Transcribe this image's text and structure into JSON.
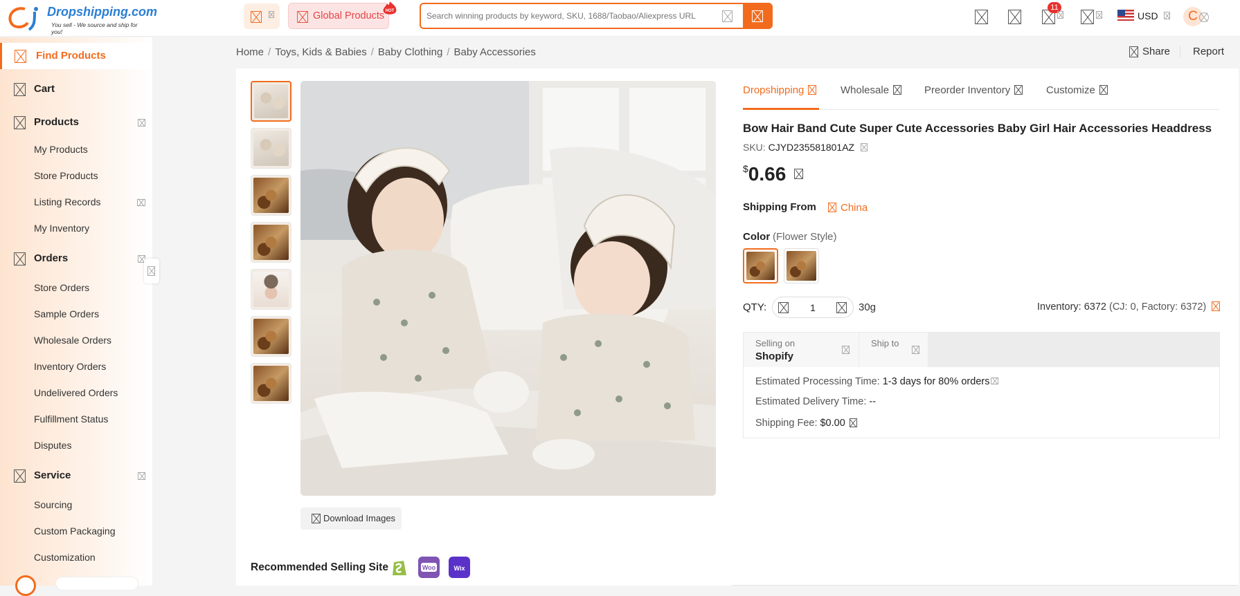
{
  "header": {
    "brand": "Dropshipping.com",
    "tagline": "You sell - We source and ship for you!",
    "global_products": "Global Products",
    "hot_badge": "HOT",
    "search_placeholder": "Search winning products by keyword, SKU, 1688/Taobao/Aliexpress URL",
    "notification_count": "11",
    "currency": "USD",
    "avatar_letter": "C"
  },
  "sidebar": {
    "find_products": "Find Products",
    "cart": "Cart",
    "products": "Products",
    "products_items": [
      "My Products",
      "Store Products",
      "Listing Records",
      "My Inventory"
    ],
    "orders": "Orders",
    "orders_items": [
      "Store Orders",
      "Sample Orders",
      "Wholesale Orders",
      "Inventory Orders",
      "Undelivered Orders",
      "Fulfillment Status",
      "Disputes"
    ],
    "service": "Service",
    "service_items": [
      "Sourcing",
      "Custom Packaging",
      "Customization"
    ]
  },
  "breadcrumb": [
    "Home",
    "Toys, Kids & Babies",
    "Baby Clothing",
    "Baby Accessories"
  ],
  "actions": {
    "share": "Share",
    "report": "Report"
  },
  "gallery": {
    "download": "Download Images"
  },
  "recommended": {
    "label": "Recommended Selling Site",
    "sites": [
      "Shopify",
      "WooCommerce",
      "Wix"
    ]
  },
  "tabs": [
    "Dropshipping",
    "Wholesale",
    "Preorder Inventory",
    "Customize"
  ],
  "product": {
    "title": "Bow Hair Band Cute Super Cute Accessories Baby Girl Hair Accessories Headdress",
    "sku_label": "SKU:",
    "sku": "CJYD235581801AZ",
    "currency_symbol": "$",
    "price": "0.66",
    "shipping_from_label": "Shipping From",
    "shipping_from": "China",
    "color_label": "Color",
    "color_value": "(Flower Style)",
    "qty_label": "QTY:",
    "qty": "1",
    "weight": "30g",
    "inventory": "Inventory: 6372",
    "inventory_detail": "(CJ: 0, Factory: 6372)"
  },
  "shipping": {
    "selling_on_label": "Selling on",
    "selling_on": "Shopify",
    "ship_to_label": "Ship to",
    "processing_label": "Estimated Processing Time:",
    "processing": "1-3 days for 80% orders",
    "delivery_label": "Estimated Delivery Time:",
    "delivery": "--",
    "fee_label": "Shipping Fee:",
    "fee": "$0.00"
  },
  "colors": {
    "accent": "#f26b1d",
    "hot": "#e54444",
    "brand_blue": "#2a7fd4"
  }
}
